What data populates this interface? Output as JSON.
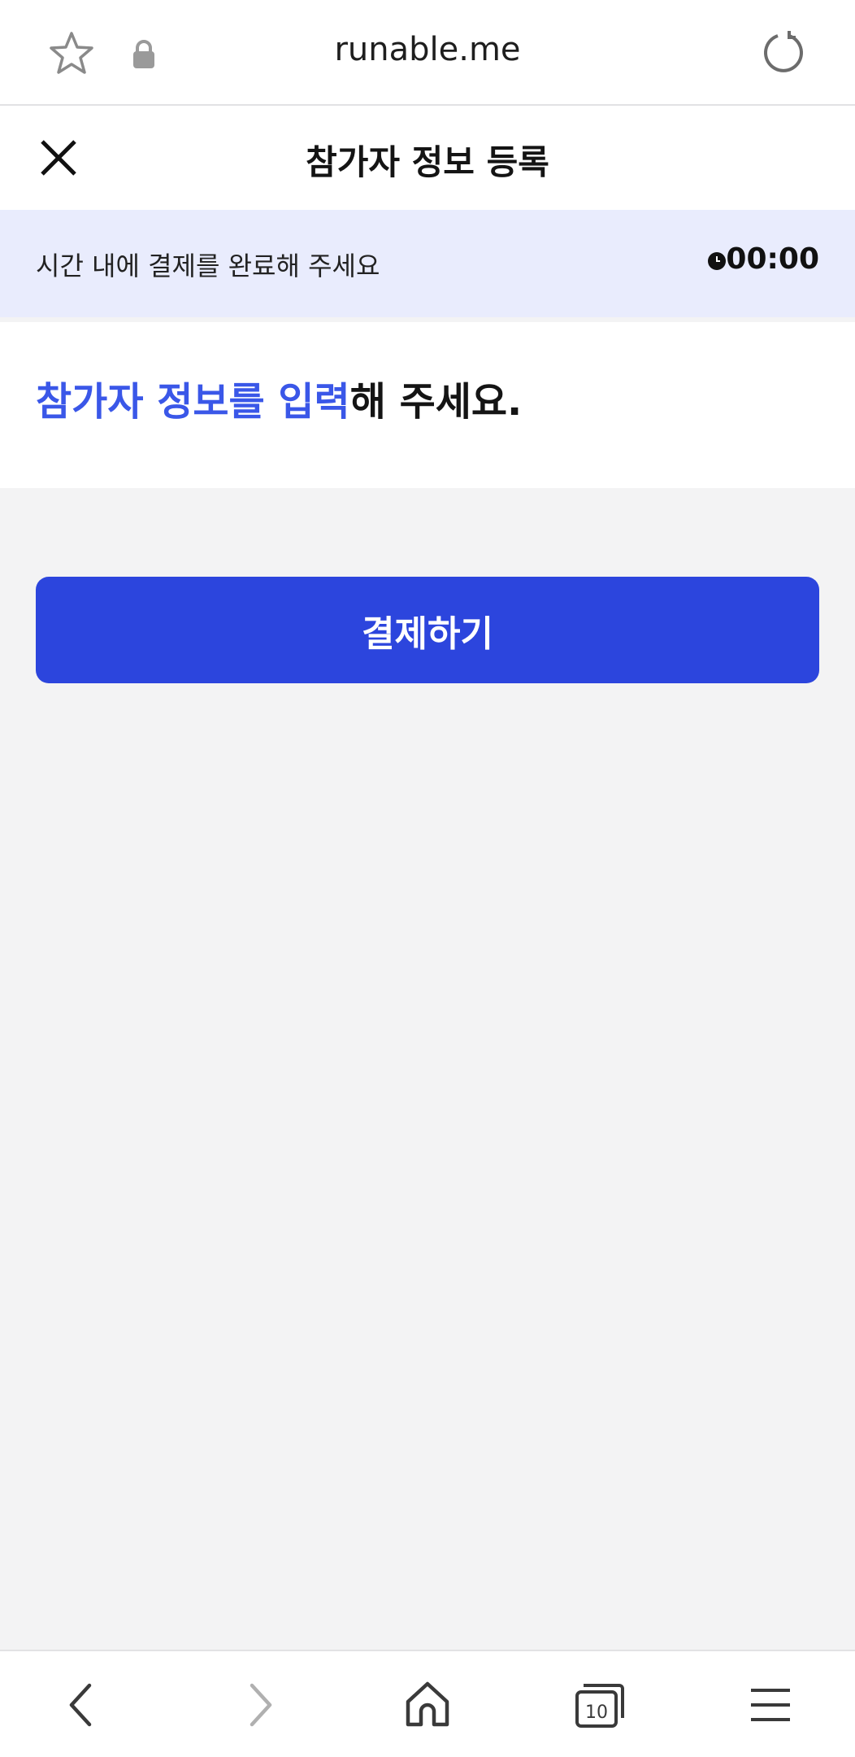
{
  "browser": {
    "url": "runable.me",
    "icons": [
      "star-icon",
      "lock-icon",
      "reload-icon"
    ]
  },
  "header": {
    "title": "참가자 정보 등록",
    "close_icon": "close-icon"
  },
  "timer": {
    "message": "시간 내에 결제를 완료해 주세요",
    "value": "00:00",
    "icon": "clock-icon"
  },
  "intro": {
    "highlight": "참가자 정보를 입력",
    "rest": "해 주세요."
  },
  "actions": {
    "pay_label": "결제하기"
  },
  "bottom_nav": {
    "tabs_count": "10",
    "icons": [
      "back-icon",
      "forward-icon",
      "home-icon",
      "tabs-icon",
      "menu-icon"
    ]
  },
  "colors": {
    "accent": "#2c45dd",
    "highlight_text": "#3a57e8",
    "banner_bg": "#e9ecfd"
  }
}
